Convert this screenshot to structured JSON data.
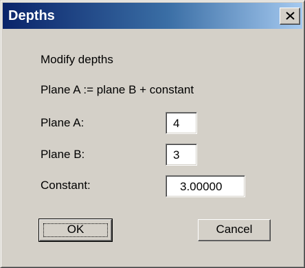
{
  "window": {
    "title": "Depths",
    "close_glyph": "✕"
  },
  "content": {
    "heading": "Modify depths",
    "formula": "Plane A := plane B + constant",
    "plane_a": {
      "label": "Plane A:",
      "value": "4"
    },
    "plane_b": {
      "label": "Plane B:",
      "value": "3"
    },
    "constant": {
      "label": "Constant:",
      "value": "3.00000"
    }
  },
  "buttons": {
    "ok_label": "OK",
    "cancel_label": "Cancel"
  },
  "colors": {
    "title_bar_start": "#0a246a",
    "title_bar_end": "#a6caf0",
    "dialog_face": "#d4d0c8"
  }
}
